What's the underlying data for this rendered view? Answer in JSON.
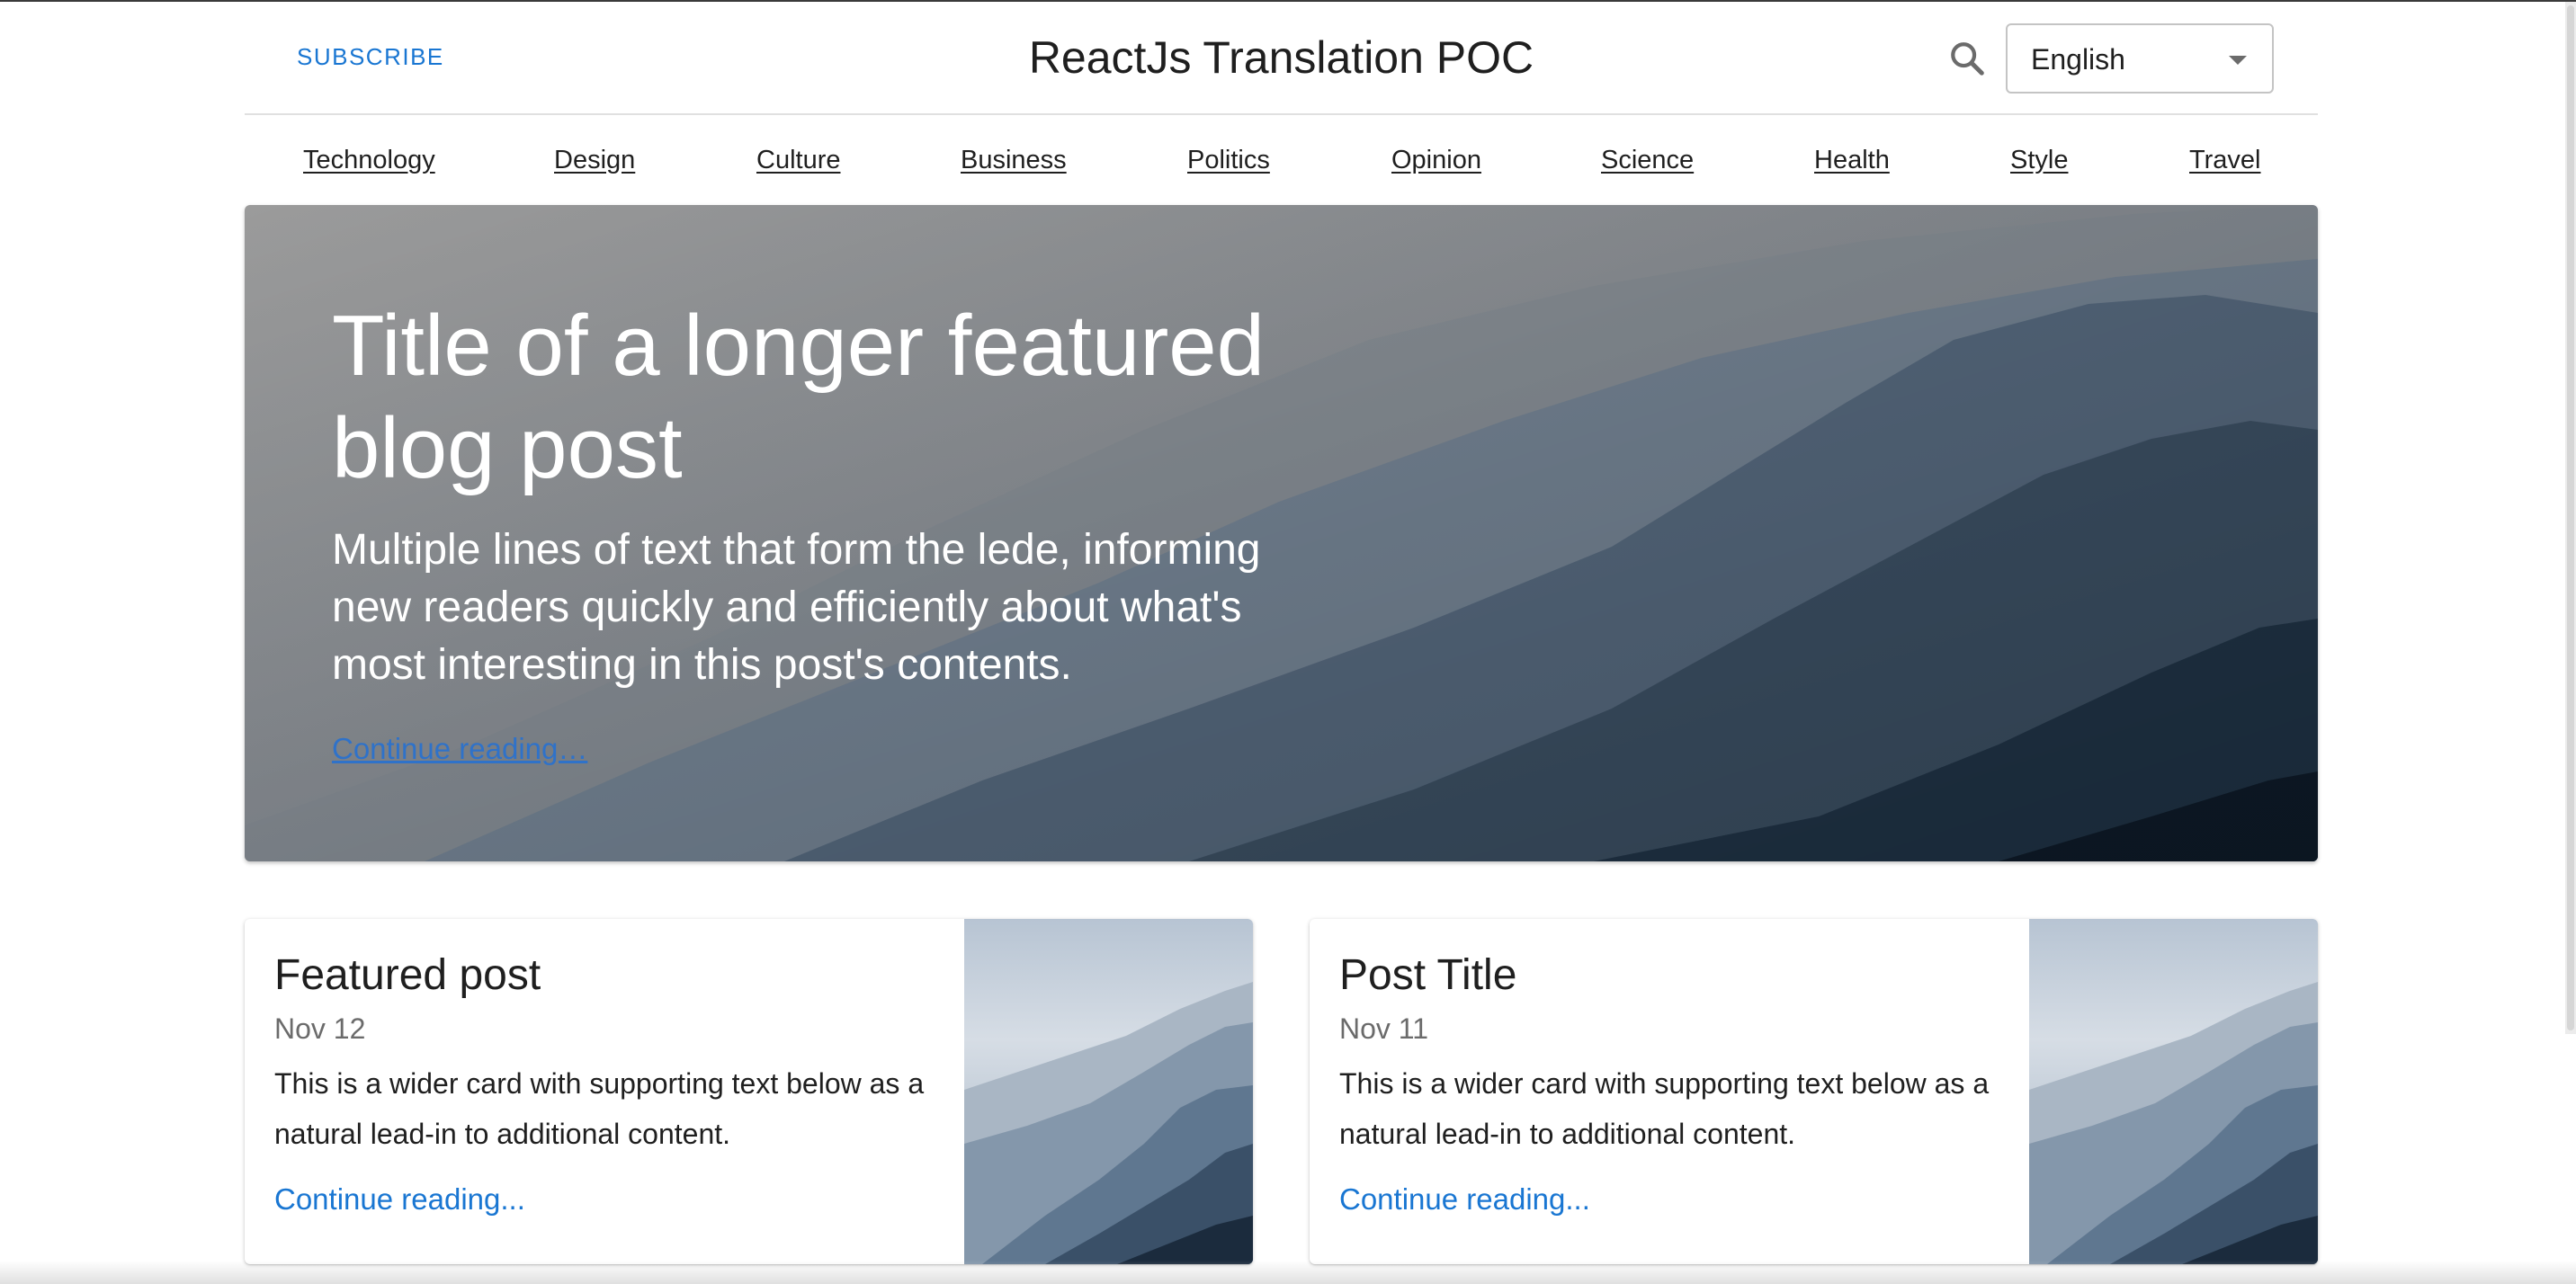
{
  "header": {
    "subscribe_label": "Subscribe",
    "title": "ReactJs Translation POC",
    "language_selected": "English"
  },
  "nav": {
    "items": [
      "Technology",
      "Design",
      "Culture",
      "Business",
      "Politics",
      "Opinion",
      "Science",
      "Health",
      "Style",
      "Travel"
    ]
  },
  "hero": {
    "title": "Title of a longer featured blog post",
    "lede": "Multiple lines of text that form the lede, informing new readers quickly and efficiently about what's most interesting in this post's contents.",
    "link_label": "Continue reading…"
  },
  "cards": [
    {
      "title": "Featured post",
      "date": "Nov 12",
      "text": "This is a wider card with supporting text below as a natural lead-in to additional content.",
      "link_label": "Continue reading..."
    },
    {
      "title": "Post Title",
      "date": "Nov 11",
      "text": "This is a wider card with supporting text below as a natural lead-in to additional content.",
      "link_label": "Continue reading..."
    }
  ],
  "colors": {
    "accent": "#1976d2",
    "text": "#1f1f1f",
    "muted": "#6b6b6b"
  }
}
